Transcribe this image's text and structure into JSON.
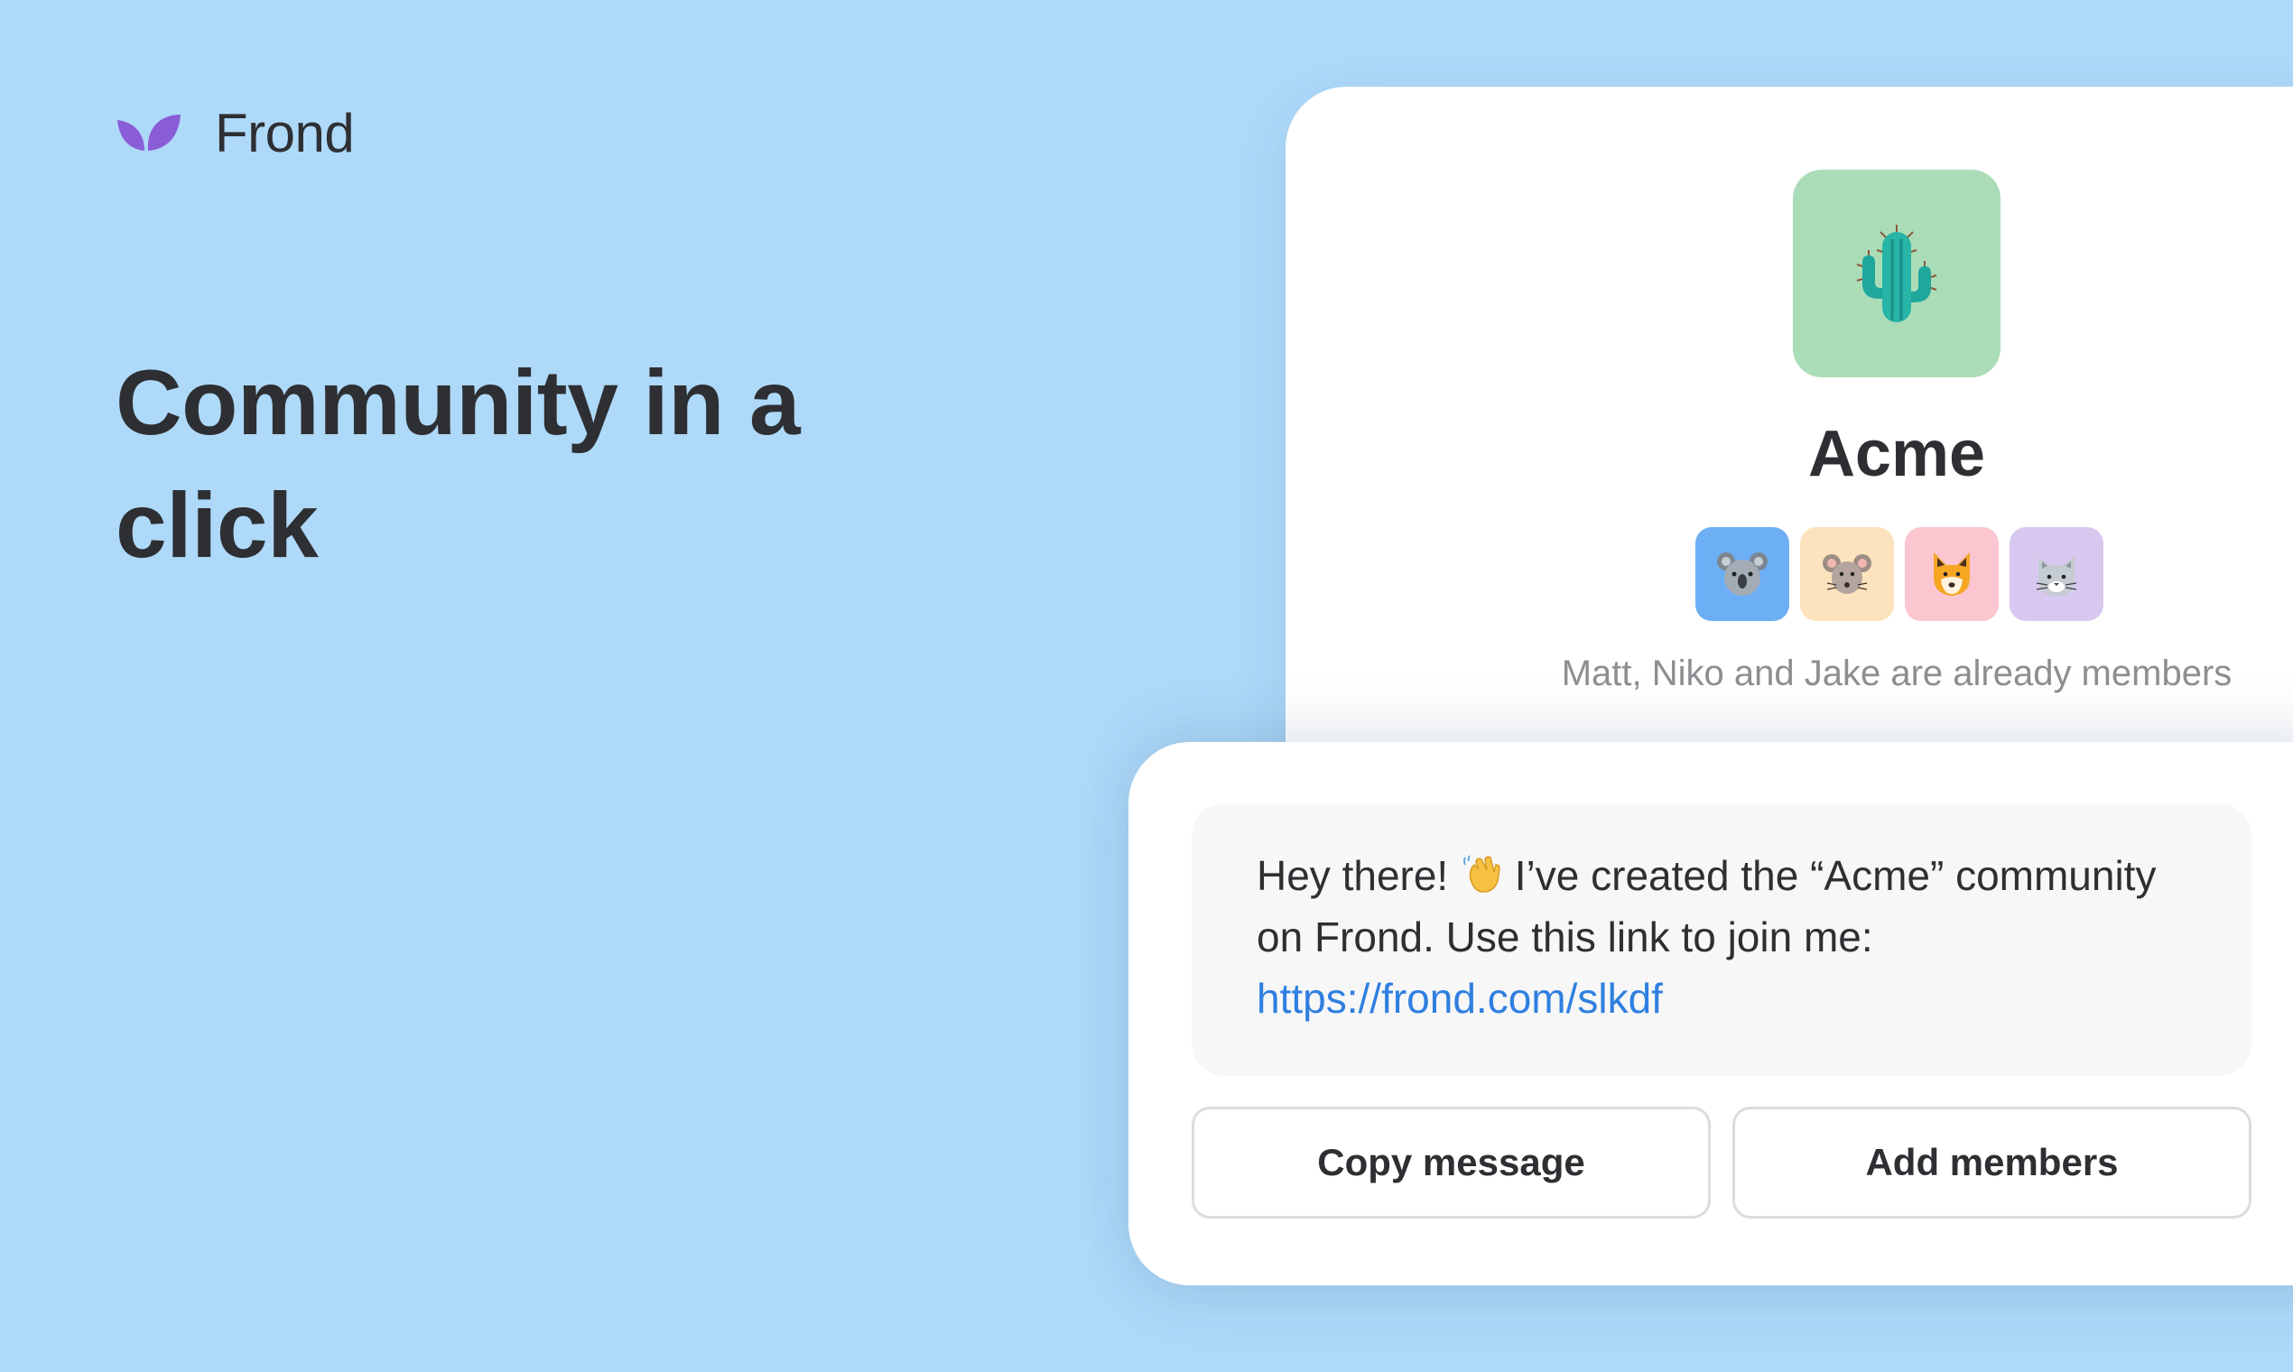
{
  "brand": {
    "name": "Frond",
    "logo_icon": "leaf-logo-icon",
    "accent": "#8a5dd6"
  },
  "hero": {
    "headline": "Community in a click"
  },
  "community": {
    "icon": "cactus-icon",
    "icon_bg": "#abdcb8",
    "name": "Acme",
    "members": [
      {
        "icon": "koala-icon",
        "bg": "#6daff5"
      },
      {
        "icon": "mouse-icon",
        "bg": "#fde3bd"
      },
      {
        "icon": "fox-icon",
        "bg": "#fbc6cf"
      },
      {
        "icon": "cat-icon",
        "bg": "#d8c8f0"
      }
    ],
    "members_text": "Matt, Niko and Jake are already members"
  },
  "invite": {
    "message_part1": "Hey there! ",
    "wave_icon": "waving-hand-icon",
    "message_part2": " I’ve created the “Acme” community on Frond. Use this link to join me:",
    "link": "https://frond.com/slkdf",
    "copy_button": "Copy message",
    "add_button": "Add members"
  },
  "colors": {
    "background": "#aed9f9",
    "link": "#2f7fe0"
  }
}
